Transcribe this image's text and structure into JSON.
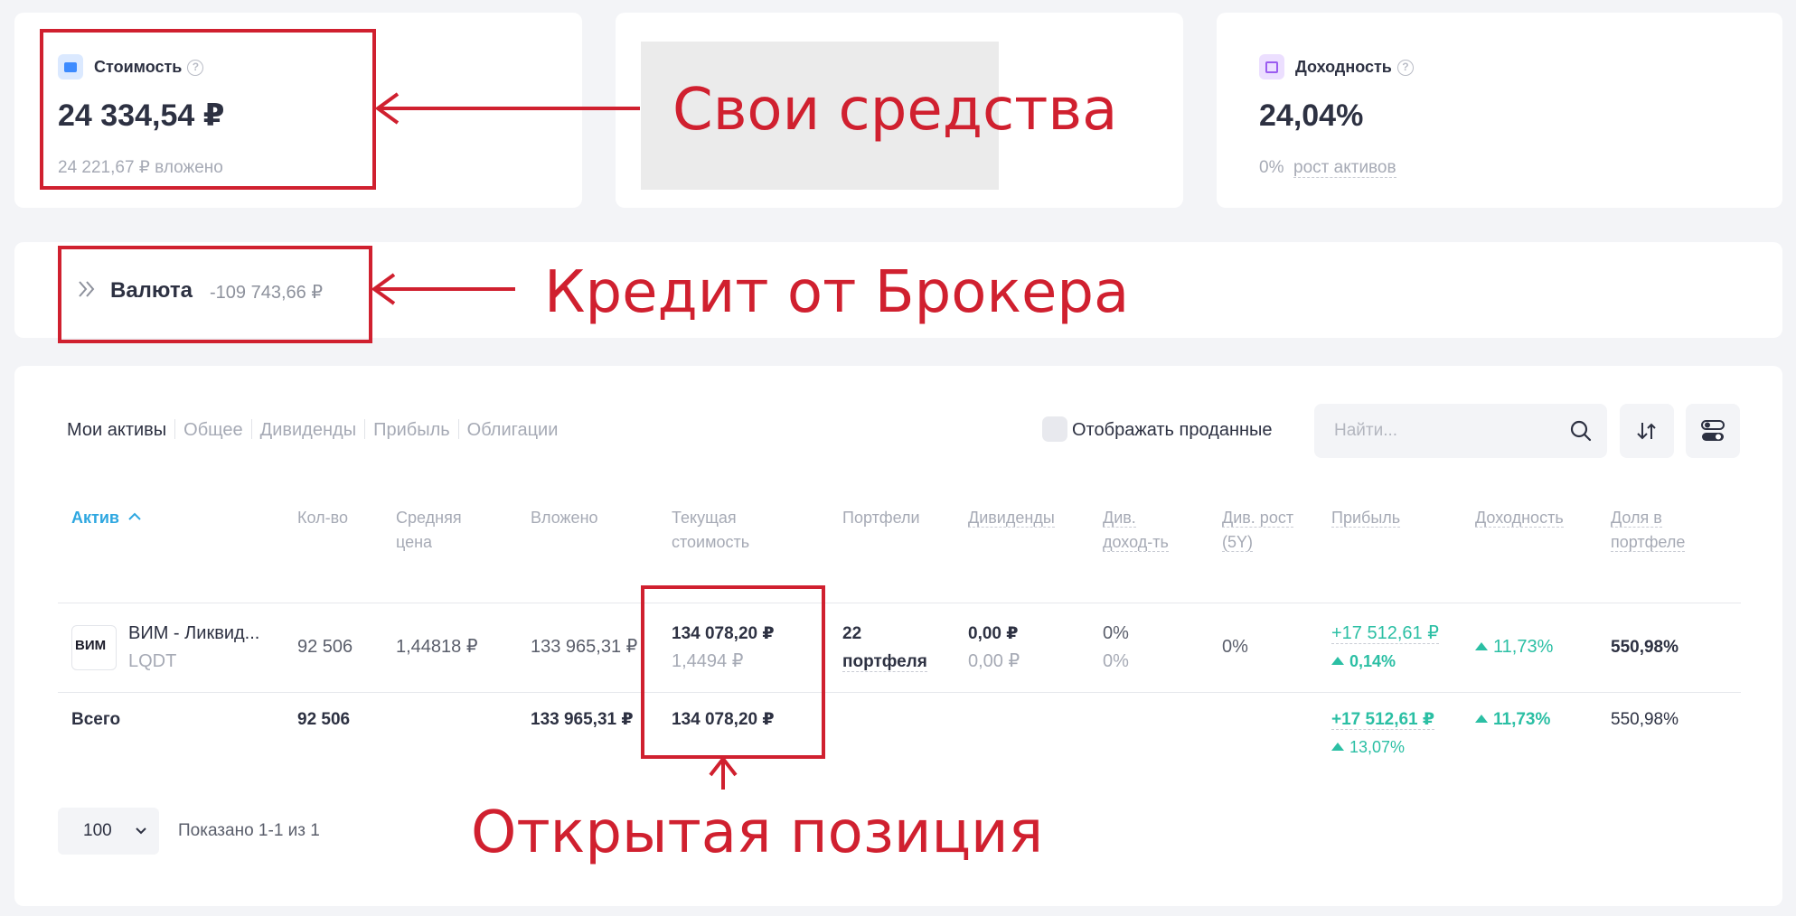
{
  "cards": {
    "cost": {
      "label": "Стоимость",
      "help": "?",
      "value": "24 334,54 ₽",
      "invested": "24 221,67 ₽ вложено"
    },
    "yield": {
      "label": "Доходность",
      "help": "?",
      "value": "24,04%",
      "growth_value": "0%",
      "growth_label": "рост активов"
    }
  },
  "currency": {
    "label": "Валюта",
    "value": "-109 743,66 ₽"
  },
  "tabs": [
    "Мои активы",
    "Общее",
    "Дивиденды",
    "Прибыль",
    "Облигации"
  ],
  "toolbar": {
    "show_sold": "Отображать проданные",
    "search_placeholder": "Найти..."
  },
  "table": {
    "headers": {
      "asset": "Актив",
      "qty": "Кол-во",
      "avg_price": [
        "Средняя",
        "цена"
      ],
      "invested": "Вложено",
      "current": [
        "Текущая",
        "стоимость"
      ],
      "portfolios": "Портфели",
      "dividends": "Дивиденды",
      "div_yield": [
        "Див.",
        "доход-ть"
      ],
      "div_growth": [
        "Див. рост",
        "(5Y)"
      ],
      "profit": "Прибыль",
      "return": "Доходность",
      "share": [
        "Доля в",
        "портфеле"
      ]
    },
    "rows": [
      {
        "logo": "ВИМ",
        "name": "ВИМ - Ликвид...",
        "ticker": "LQDT",
        "qty": "92 506",
        "avg_price": "1,44818 ₽",
        "invested": "133 965,31 ₽",
        "current": "134 078,20 ₽",
        "current_price": "1,4494 ₽",
        "portfolios": [
          "22",
          "портфеля"
        ],
        "dividends": "0,00 ₽",
        "dividends_sub": "0,00 ₽",
        "div_yield": "0%",
        "div_yield_sub": "0%",
        "div_growth": "0%",
        "profit": "+17 512,61 ₽",
        "profit_pct": "0,14%",
        "return": "11,73%",
        "share": "550,98%"
      }
    ],
    "total": {
      "label": "Всего",
      "qty": "92 506",
      "invested": "133 965,31 ₽",
      "current": "134 078,20 ₽",
      "profit": "+17 512,61 ₽",
      "profit_pct": "13,07%",
      "return": "11,73%",
      "share": "550,98%"
    }
  },
  "pagination": {
    "page_size": "100",
    "shown": "Показано 1-1 из 1"
  },
  "annotations": {
    "own_funds": "Свои средства",
    "broker_credit": "Кредит от Брокера",
    "open_position": "Открытая позиция"
  },
  "colors": {
    "accent_red": "#d0202f",
    "green": "#2bbfa4",
    "link_blue": "#2ea7e0"
  },
  "icons": [
    "wallet-icon",
    "calendar-icon",
    "help-icon",
    "chevron-right-icon",
    "search-icon",
    "sort-icon",
    "toggle-icon",
    "chevron-down-icon",
    "triangle-up-icon",
    "sort-asc-icon"
  ]
}
